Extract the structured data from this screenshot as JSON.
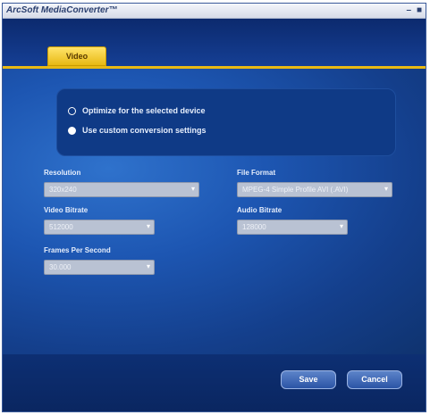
{
  "window": {
    "title": "ArcSoft MediaConverter™",
    "minimize": "–",
    "close": "■"
  },
  "tabs": [
    {
      "label": "Video"
    }
  ],
  "options": {
    "items": [
      {
        "label": "Optimize for the selected device",
        "checked": false
      },
      {
        "label": "Use custom conversion settings",
        "checked": true
      }
    ]
  },
  "fields": {
    "resolution": {
      "label": "Resolution",
      "value": "320x240"
    },
    "file_format": {
      "label": "File Format",
      "value": "MPEG-4 Simple Profile AVI (.AVI)"
    },
    "video_bitrate": {
      "label": "Video Bitrate",
      "value": "512000"
    },
    "audio_bitrate": {
      "label": "Audio Bitrate",
      "value": "128000"
    },
    "frames_per_second": {
      "label": "Frames Per Second",
      "value": "30.000"
    }
  },
  "buttons": {
    "save": "Save",
    "cancel": "Cancel"
  },
  "icons": {
    "dropdown": "▾"
  },
  "colors": {
    "accent_tab": "#e8b914",
    "panel": "#1d56b2"
  }
}
